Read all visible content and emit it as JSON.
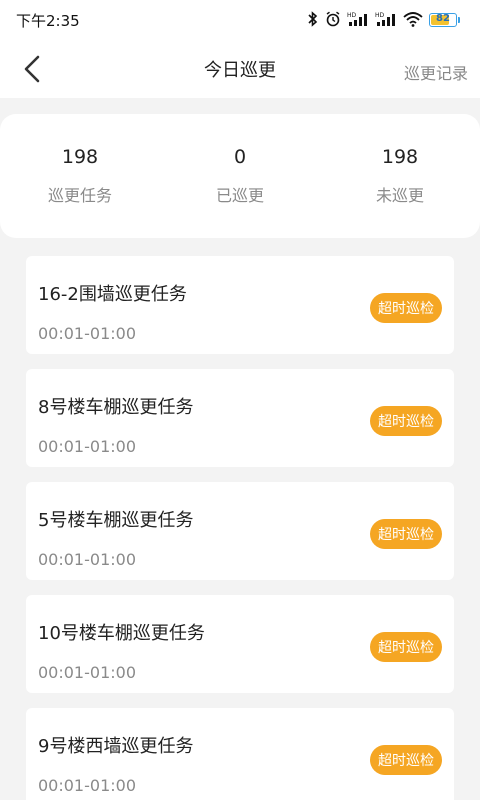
{
  "status_bar": {
    "time": "下午2:35",
    "icons": [
      "bluetooth-icon",
      "alarm-icon",
      "hd-signal-icon",
      "hd-signal-icon",
      "wifi-icon"
    ],
    "hd_label": "HD",
    "battery_level": "82"
  },
  "header": {
    "title": "今日巡更",
    "right_action": "巡更记录"
  },
  "stats": [
    {
      "value": "198",
      "label": "巡更任务"
    },
    {
      "value": "0",
      "label": "已巡更"
    },
    {
      "value": "198",
      "label": "未巡更"
    }
  ],
  "tasks": [
    {
      "name": "16-2围墙巡更任务",
      "time": "00:01-01:00",
      "status": "超时巡检"
    },
    {
      "name": "8号楼车棚巡更任务",
      "time": "00:01-01:00",
      "status": "超时巡检"
    },
    {
      "name": "5号楼车棚巡更任务",
      "time": "00:01-01:00",
      "status": "超时巡检"
    },
    {
      "name": "10号楼车棚巡更任务",
      "time": "00:01-01:00",
      "status": "超时巡检"
    },
    {
      "name": "9号楼西墙巡更任务",
      "time": "00:01-01:00",
      "status": "超时巡检"
    }
  ],
  "colors": {
    "badge": "#f5a623",
    "background": "#f3f3f3"
  }
}
